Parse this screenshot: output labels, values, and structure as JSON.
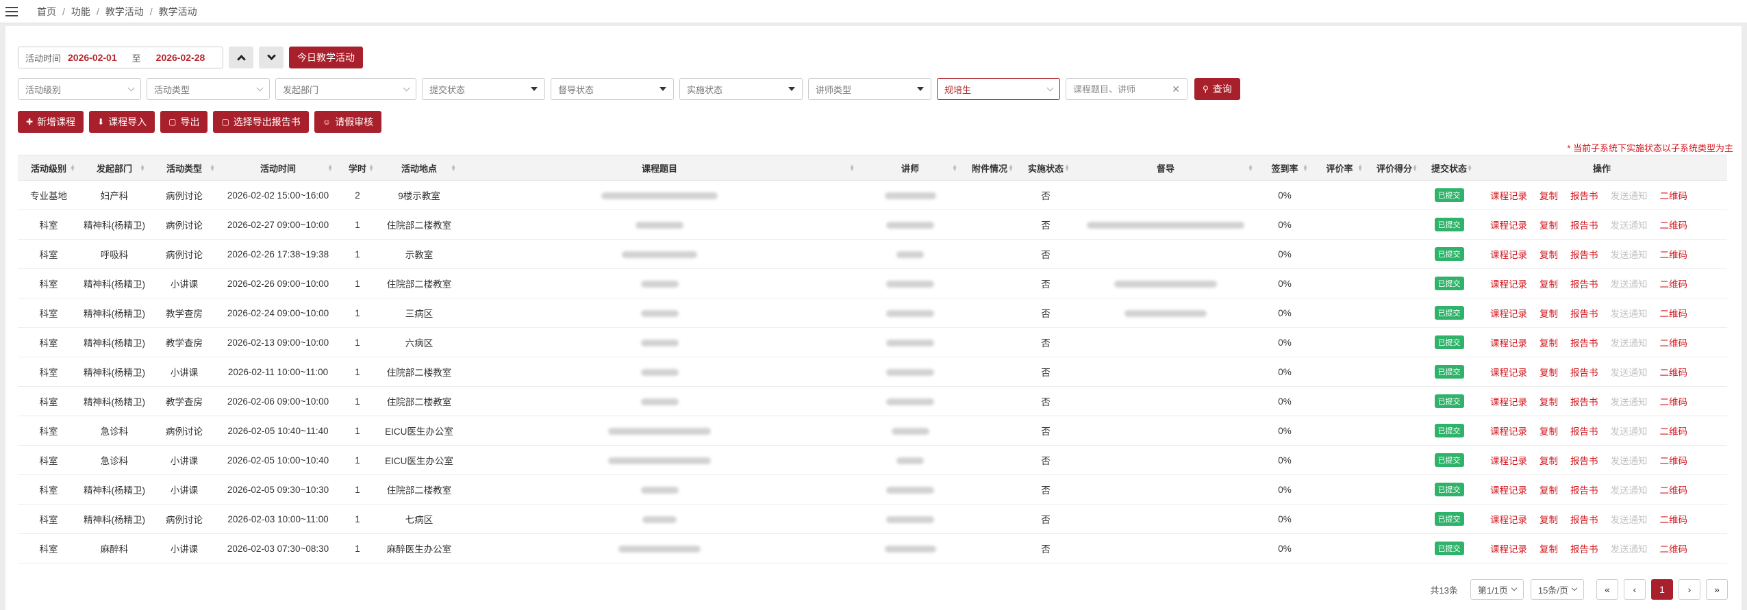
{
  "breadcrumb": [
    "首页",
    "功能",
    "教学活动",
    "教学活动"
  ],
  "date_range": {
    "label": "活动时间",
    "start": "2026-02-01",
    "to": "至",
    "end": "2026-02-28"
  },
  "today_button": "今日教学活动",
  "filters": {
    "level": "活动级别",
    "type": "活动类型",
    "dept": "发起部门",
    "submit_status": "提交状态",
    "supervise_status": "督导状态",
    "impl_status": "实施状态",
    "lecturer_type": "讲师类型",
    "trainee": "规培生",
    "search_placeholder": "课程题目、讲师",
    "query_button": "查询"
  },
  "actions": {
    "add": "新增课程",
    "import": "课程导入",
    "export": "导出",
    "export_report": "选择导出报告书",
    "leave": "请假审核"
  },
  "note": "* 当前子系统下实施状态以子系统类型为主",
  "columns": [
    "活动级别",
    "发起部门",
    "活动类型",
    "活动时间",
    "学时",
    "活动地点",
    "课程题目",
    "讲师",
    "附件情况",
    "实施状态",
    "督导",
    "签到率",
    "评价率",
    "评价得分",
    "提交状态",
    "操作"
  ],
  "ops": [
    "课程记录",
    "复制",
    "报告书",
    "发送通知",
    "二维码"
  ],
  "rows": [
    {
      "level": "专业基地",
      "dept": "妇产科",
      "type": "病例讨论",
      "time": "2026-02-02  15:00~16:00",
      "hours": "2",
      "place": "9楼示教室",
      "impl": "否",
      "sign": "0%",
      "status": "已提交"
    },
    {
      "level": "科室",
      "dept": "精神科(杨精卫)",
      "type": "病例讨论",
      "time": "2026-02-27  09:00~10:00",
      "hours": "1",
      "place": "住院部二楼教室",
      "impl": "否",
      "sign": "0%",
      "status": "已提交"
    },
    {
      "level": "科室",
      "dept": "呼吸科",
      "type": "病例讨论",
      "time": "2026-02-26  17:38~19:38",
      "hours": "1",
      "place": "示教室",
      "impl": "否",
      "sign": "0%",
      "status": "已提交"
    },
    {
      "level": "科室",
      "dept": "精神科(杨精卫)",
      "type": "小讲课",
      "time": "2026-02-26  09:00~10:00",
      "hours": "1",
      "place": "住院部二楼教室",
      "impl": "否",
      "sign": "0%",
      "status": "已提交"
    },
    {
      "level": "科室",
      "dept": "精神科(杨精卫)",
      "type": "教学查房",
      "time": "2026-02-24  09:00~10:00",
      "hours": "1",
      "place": "三病区",
      "impl": "否",
      "sign": "0%",
      "status": "已提交"
    },
    {
      "level": "科室",
      "dept": "精神科(杨精卫)",
      "type": "教学查房",
      "time": "2026-02-13  09:00~10:00",
      "hours": "1",
      "place": "六病区",
      "impl": "否",
      "sign": "0%",
      "status": "已提交"
    },
    {
      "level": "科室",
      "dept": "精神科(杨精卫)",
      "type": "小讲课",
      "time": "2026-02-11  10:00~11:00",
      "hours": "1",
      "place": "住院部二楼教室",
      "impl": "否",
      "sign": "0%",
      "status": "已提交"
    },
    {
      "level": "科室",
      "dept": "精神科(杨精卫)",
      "type": "教学查房",
      "time": "2026-02-06  09:00~10:00",
      "hours": "1",
      "place": "住院部二楼教室",
      "impl": "否",
      "sign": "0%",
      "status": "已提交"
    },
    {
      "level": "科室",
      "dept": "急诊科",
      "type": "病例讨论",
      "time": "2026-02-05  10:40~11:40",
      "hours": "1",
      "place": "EICU医生办公室",
      "impl": "否",
      "sign": "0%",
      "status": "已提交"
    },
    {
      "level": "科室",
      "dept": "急诊科",
      "type": "小讲课",
      "time": "2026-02-05  10:00~10:40",
      "hours": "1",
      "place": "EICU医生办公室",
      "impl": "否",
      "sign": "0%",
      "status": "已提交"
    },
    {
      "level": "科室",
      "dept": "精神科(杨精卫)",
      "type": "小讲课",
      "time": "2026-02-05  09:30~10:30",
      "hours": "1",
      "place": "住院部二楼教室",
      "impl": "否",
      "sign": "0%",
      "status": "已提交"
    },
    {
      "level": "科室",
      "dept": "精神科(杨精卫)",
      "type": "病例讨论",
      "time": "2026-02-03  10:00~11:00",
      "hours": "1",
      "place": "七病区",
      "impl": "否",
      "sign": "0%",
      "status": "已提交"
    },
    {
      "level": "科室",
      "dept": "麻醉科",
      "type": "小讲课",
      "time": "2026-02-03  07:30~08:30",
      "hours": "1",
      "place": "麻醉医生办公室",
      "impl": "否",
      "sign": "0%",
      "status": "已提交"
    }
  ],
  "pagination": {
    "total": "共13条",
    "page": "第1/1页",
    "size": "15条/页",
    "current": "1",
    "first": "«",
    "prev": "‹",
    "next": "›",
    "last": "»"
  }
}
